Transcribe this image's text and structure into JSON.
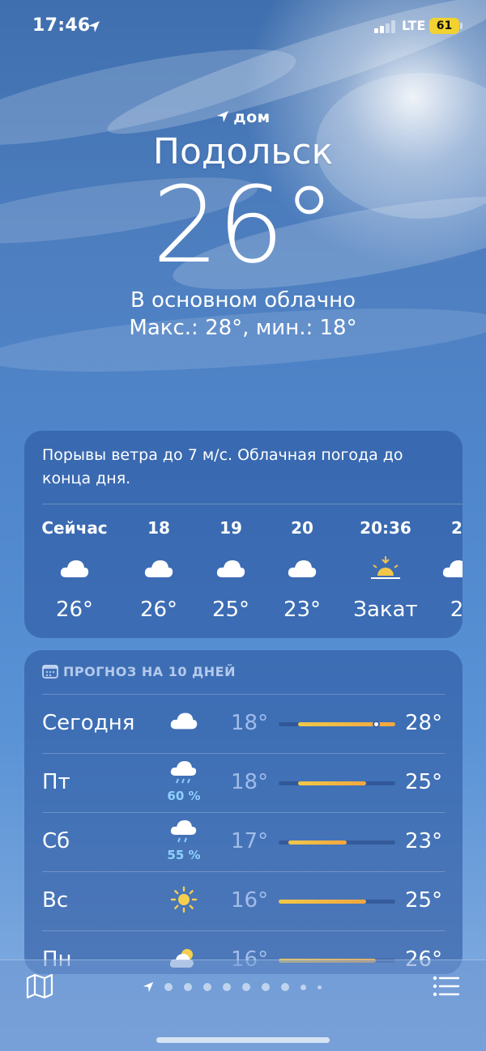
{
  "status_bar": {
    "time": "17:46",
    "network": "LTE",
    "battery": "61"
  },
  "location": {
    "label": "дом",
    "city": "Подольск"
  },
  "current": {
    "temperature": "26°",
    "condition": "В основном облачно",
    "hi_lo": "Макс.: 28°, мин.: 18°"
  },
  "hourly": {
    "summary": "Порывы ветра до 7 м/с. Облачная погода до конца дня.",
    "items": [
      {
        "label": "Сейчас",
        "icon": "cloud-icon",
        "temp": "26°"
      },
      {
        "label": "18",
        "icon": "cloud-icon",
        "temp": "26°"
      },
      {
        "label": "19",
        "icon": "cloud-icon",
        "temp": "25°"
      },
      {
        "label": "20",
        "icon": "cloud-icon",
        "temp": "23°"
      },
      {
        "label": "20:36",
        "icon": "sunset-icon",
        "temp": "Закат"
      },
      {
        "label": "2",
        "icon": "partly-cloudy-icon",
        "temp": "2"
      }
    ]
  },
  "daily": {
    "header": "ПРОГНОЗ НА 10 ДНЕЙ",
    "range_min": 16,
    "range_max": 28,
    "current_temp": 26,
    "days": [
      {
        "name": "Сегодня",
        "icon": "cloud-icon",
        "precip": "",
        "min": "18°",
        "max": "28°",
        "lo": 18,
        "hi": 28
      },
      {
        "name": "Пт",
        "icon": "rain-icon",
        "precip": "60 %",
        "min": "18°",
        "max": "25°",
        "lo": 18,
        "hi": 25
      },
      {
        "name": "Сб",
        "icon": "rain-icon",
        "precip": "55 %",
        "min": "17°",
        "max": "23°",
        "lo": 17,
        "hi": 23
      },
      {
        "name": "Вс",
        "icon": "sun-icon",
        "precip": "",
        "min": "16°",
        "max": "25°",
        "lo": 16,
        "hi": 25
      },
      {
        "name": "Пн",
        "icon": "partly-sunny-icon",
        "precip": "",
        "min": "16°",
        "max": "26°",
        "lo": 16,
        "hi": 26
      }
    ]
  },
  "colors": {
    "bar_cool": "#f0c848",
    "bar_warm": "#f2a640"
  }
}
